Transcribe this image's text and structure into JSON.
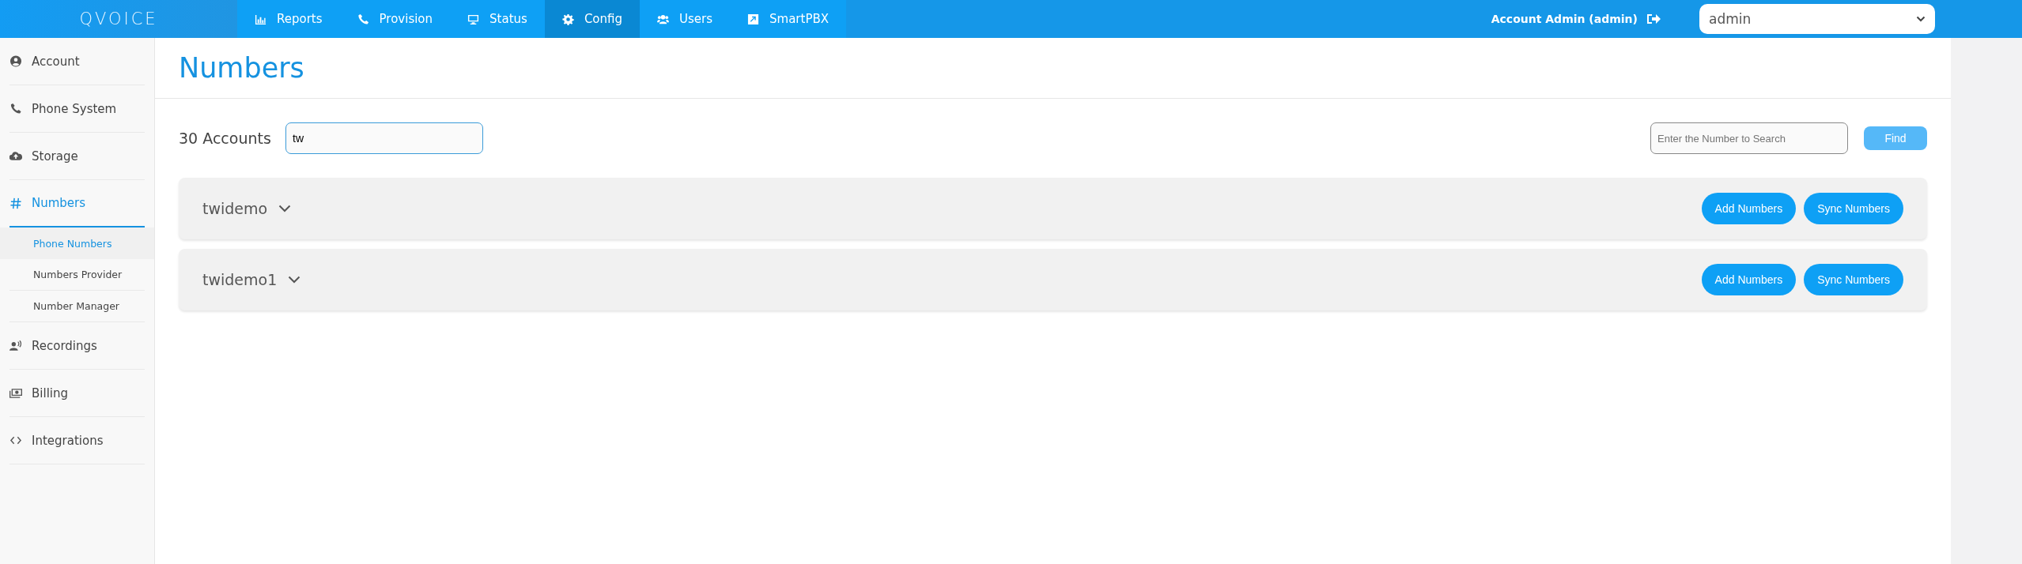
{
  "topbar": {
    "logo": "QVOICE",
    "nav": [
      {
        "label": "Reports",
        "selected": false
      },
      {
        "label": "Provision",
        "selected": false
      },
      {
        "label": "Status",
        "selected": false
      },
      {
        "label": "Config",
        "selected": true
      },
      {
        "label": "Users",
        "selected": false
      },
      {
        "label": "SmartPBX",
        "selected": false
      }
    ],
    "user": "Account Admin (admin)",
    "account_select": {
      "value": "admin"
    }
  },
  "sidebar": {
    "items": [
      {
        "label": "Account",
        "selected": false
      },
      {
        "label": "Phone System",
        "selected": false
      },
      {
        "label": "Storage",
        "selected": false
      },
      {
        "label": "Numbers",
        "selected": true,
        "children": [
          {
            "label": "Phone Numbers",
            "selected": true
          },
          {
            "label": "Numbers Provider",
            "selected": false
          },
          {
            "label": "Number Manager",
            "selected": false
          }
        ]
      },
      {
        "label": "Recordings",
        "selected": false
      },
      {
        "label": "Billing",
        "selected": false
      },
      {
        "label": "Integrations",
        "selected": false
      }
    ]
  },
  "page": {
    "title": "Numbers",
    "count": "30 Accounts",
    "account_filter": {
      "value": "tw"
    },
    "number_search": {
      "placeholder": "Enter the Number to Search"
    },
    "find_button": "Find",
    "accounts": [
      {
        "name": "twidemo",
        "expanded": false,
        "buttons": [
          "Add Numbers",
          "Sync Numbers"
        ]
      },
      {
        "name": "twidemo1",
        "expanded": false,
        "buttons": [
          "Add Numbers",
          "Sync Numbers"
        ]
      }
    ]
  }
}
